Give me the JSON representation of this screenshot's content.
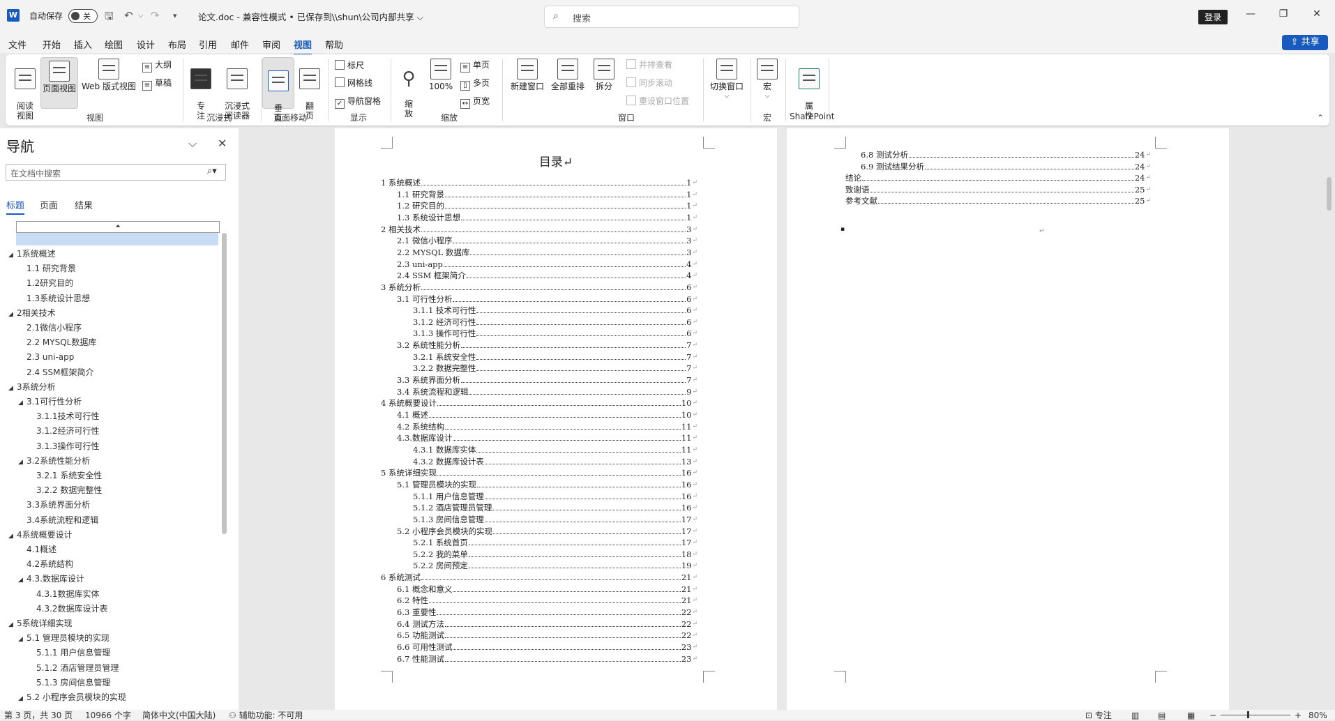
{
  "titlebar": {
    "app_icon": "W",
    "autosave_label": "自动保存",
    "autosave_state": "关",
    "doc_title": "论文.doc  -  兼容性模式 • 已保存到\\\\shun\\公司内部共享 ⌵",
    "search_placeholder": "搜索",
    "login_label": "登录"
  },
  "menu": {
    "tabs": [
      "文件",
      "开始",
      "插入",
      "绘图",
      "设计",
      "布局",
      "引用",
      "邮件",
      "审阅",
      "视图",
      "帮助"
    ],
    "active_tab": "视图",
    "share_label": "共享"
  },
  "ribbon": {
    "groups": {
      "views": "视图",
      "immersive": "沉浸式",
      "page_move": "页面移动",
      "show": "显示",
      "zoom": "缩放",
      "window": "窗口",
      "macros": "宏",
      "sharepoint": "SharePoint"
    },
    "read_view": "阅读\n视图",
    "page_view": "页面视图",
    "web_view": "Web 版式视图",
    "outline": "大纲",
    "draft": "草稿",
    "focus": "专\n注",
    "immersive_reader": "沉浸式\n阅读器",
    "vertical": "垂\n直",
    "side_to_side": "翻\n页",
    "ruler": "标尺",
    "gridlines": "网格线",
    "nav_pane": "导航窗格",
    "zoom_label": "缩\n放",
    "zoom_100": "100%",
    "one_page": "单页",
    "multi_page": "多页",
    "page_width": "页宽",
    "new_window": "新建窗口",
    "arrange_all": "全部重排",
    "split": "拆分",
    "view_side_by_side": "并排查看",
    "sync_scroll": "同步滚动",
    "reset_window": "重设窗口位置",
    "switch_window": "切换窗口",
    "macros_btn": "宏",
    "properties": "属\n性"
  },
  "nav": {
    "title": "导航",
    "search_placeholder": "在文档中搜索",
    "tabs": [
      "标题",
      "页面",
      "结果"
    ],
    "top_glyph": "⏶",
    "items": [
      {
        "label": "1系统概述",
        "arrow": "◢"
      },
      {
        "label": "1.1 研究背景",
        "arrow": ""
      },
      {
        "label": "1.2研究目的",
        "arrow": ""
      },
      {
        "label": "1.3系统设计思想",
        "arrow": ""
      },
      {
        "label": "2相关技术",
        "arrow": "◢"
      },
      {
        "label": "2.1微信小程序",
        "arrow": ""
      },
      {
        "label": "2.2 MYSQL数据库",
        "arrow": ""
      },
      {
        "label": "2.3 uni-app",
        "arrow": ""
      },
      {
        "label": "2.4 SSM框架简介",
        "arrow": ""
      },
      {
        "label": "3系统分析",
        "arrow": "◢"
      },
      {
        "label": "3.1可行性分析",
        "arrow": "◢"
      },
      {
        "label": "3.1.1技术可行性",
        "arrow": ""
      },
      {
        "label": "3.1.2经济可行性",
        "arrow": ""
      },
      {
        "label": "3.1.3操作可行性",
        "arrow": ""
      },
      {
        "label": "3.2系统性能分析",
        "arrow": "◢"
      },
      {
        "label": "3.2.1 系统安全性",
        "arrow": ""
      },
      {
        "label": "3.2.2 数据完整性",
        "arrow": ""
      },
      {
        "label": "3.3系统界面分析",
        "arrow": ""
      },
      {
        "label": "3.4系统流程和逻辑",
        "arrow": ""
      },
      {
        "label": "4系统概要设计",
        "arrow": "◢"
      },
      {
        "label": "4.1概述",
        "arrow": ""
      },
      {
        "label": "4.2系统结构",
        "arrow": ""
      },
      {
        "label": "4.3.数据库设计",
        "arrow": "◢"
      },
      {
        "label": "4.3.1数据库实体",
        "arrow": ""
      },
      {
        "label": "4.3.2数据库设计表",
        "arrow": ""
      },
      {
        "label": "5系统详细实现",
        "arrow": "◢"
      },
      {
        "label": "5.1 管理员模块的实现",
        "arrow": "◢"
      },
      {
        "label": "5.1.1 用户信息管理",
        "arrow": ""
      },
      {
        "label": "5.1.2 酒店管理员管理",
        "arrow": ""
      },
      {
        "label": "5.1.3 房间信息管理",
        "arrow": ""
      },
      {
        "label": "5.2 小程序会员模块的实现",
        "arrow": "◢"
      }
    ]
  },
  "doc": {
    "toc_title": "目录↵",
    "return_mark": "↵",
    "toc_page1": [
      {
        "text": "1 系统概述",
        "page": "1"
      },
      {
        "text": "1.1  研究背景",
        "page": "1"
      },
      {
        "text": "1.2 研究目的",
        "page": "1"
      },
      {
        "text": "1.3 系统设计思想",
        "page": "1"
      },
      {
        "text": "2 相关技术",
        "page": "3"
      },
      {
        "text": "2.1 微信小程序",
        "page": "3"
      },
      {
        "text": "2.2 MYSQL 数据库",
        "page": "3"
      },
      {
        "text": "2.3 uni-app",
        "page": "4"
      },
      {
        "text": "2.4 SSM 框架简介",
        "page": "4"
      },
      {
        "text": "3 系统分析",
        "page": "6"
      },
      {
        "text": "3.1 可行性分析",
        "page": "6"
      },
      {
        "text": "3.1.1 技术可行性",
        "page": "6"
      },
      {
        "text": "3.1.2 经济可行性",
        "page": "6"
      },
      {
        "text": "3.1.3 操作可行性",
        "page": "6"
      },
      {
        "text": "3.2 系统性能分析",
        "page": "7"
      },
      {
        "text": "3.2.1  系统安全性",
        "page": "7"
      },
      {
        "text": "3.2.2  数据完整性",
        "page": "7"
      },
      {
        "text": "3.3 系统界面分析",
        "page": "7"
      },
      {
        "text": "3.4 系统流程和逻辑",
        "page": "9"
      },
      {
        "text": "4 系统概要设计",
        "page": "10"
      },
      {
        "text": "4.1 概述",
        "page": "10"
      },
      {
        "text": "4.2 系统结构",
        "page": "11"
      },
      {
        "text": "4.3.数据库设计",
        "page": "11"
      },
      {
        "text": "4.3.1 数据库实体",
        "page": "11"
      },
      {
        "text": "4.3.2 数据库设计表",
        "page": "13"
      },
      {
        "text": "5 系统详细实现",
        "page": "16"
      },
      {
        "text": "5.1  管理员模块的实现",
        "page": "16"
      },
      {
        "text": "5.1.1  用户信息管理",
        "page": "16"
      },
      {
        "text": "5.1.2  酒店管理员管理",
        "page": "16"
      },
      {
        "text": "5.1.3  房间信息管理",
        "page": "17"
      },
      {
        "text": "5.2  小程序会员模块的实现",
        "page": "17"
      },
      {
        "text": "5.2.1  系统首页",
        "page": "17"
      },
      {
        "text": "5.2.2  我的菜单",
        "page": "18"
      },
      {
        "text": "5.2.2  房间预定",
        "page": "19"
      },
      {
        "text": "6 系统测试",
        "page": "21"
      },
      {
        "text": "6.1 概念和意义",
        "page": "21"
      },
      {
        "text": "6.2 特性",
        "page": "21"
      },
      {
        "text": "6.3 重要性",
        "page": "22"
      },
      {
        "text": "6.4 测试方法",
        "page": "22"
      },
      {
        "text": "6.5  功能测试",
        "page": "22"
      },
      {
        "text": "6.6 可用性测试",
        "page": "23"
      },
      {
        "text": "6.7 性能测试",
        "page": "23"
      }
    ],
    "toc_page2": [
      {
        "text": "6.8 测试分析",
        "page": "24"
      },
      {
        "text": "6.9 测试结果分析",
        "page": "24"
      },
      {
        "text": "结论",
        "page": "24"
      },
      {
        "text": "致谢语",
        "page": "25"
      },
      {
        "text": "参考文献",
        "page": "25"
      }
    ]
  },
  "status": {
    "page": "第 3 页，共 30 页",
    "words": "10966 个字",
    "language": "简体中文(中国大陆)",
    "accessibility": "辅助功能: 不可用",
    "focus": "专注",
    "zoom": "80%"
  }
}
